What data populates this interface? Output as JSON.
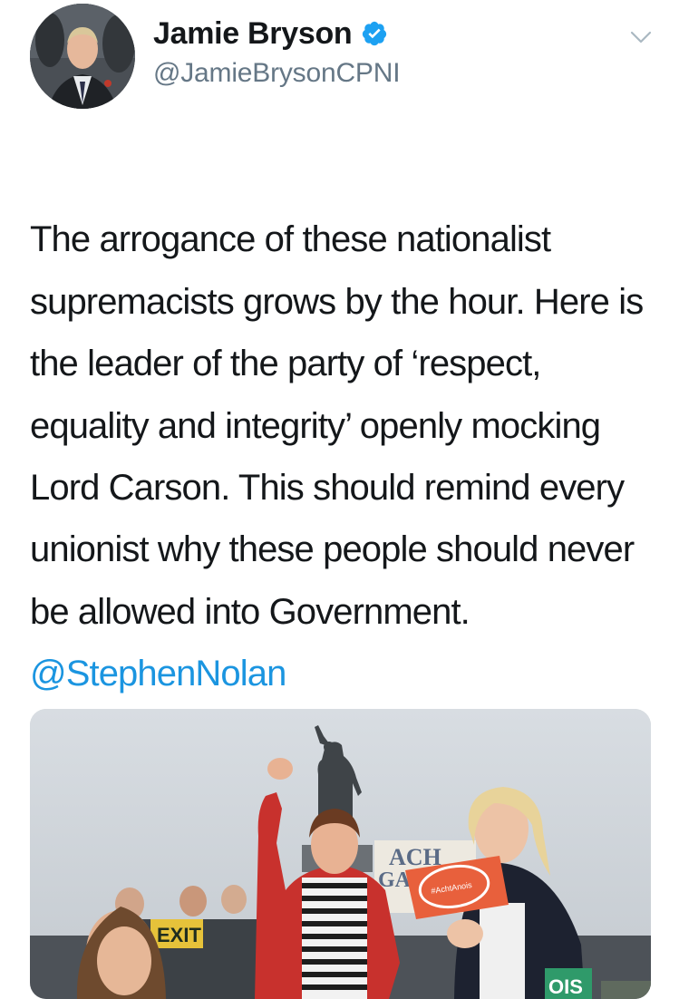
{
  "tweet": {
    "author": {
      "display_name": "Jamie Bryson",
      "handle": "@JamieBrysonCPNI",
      "verified": true
    },
    "body": "The arrogance of these nationalist supremacists grows by the hour. Here is the leader of the party of ‘respect, equality and integrity’ openly mocking Lord Carson. This should remind every unionist why these people should never be allowed into Government.",
    "mention": "@StephenNolan",
    "media": {
      "sign_text_1": "ACH",
      "sign_text_2": "GAE",
      "sign_text_3": "EXIT",
      "sign_text_4": "#AchtAnois",
      "sign_text_5": "OIS"
    }
  },
  "icons": {
    "verified": "verified-badge-icon",
    "more": "chevron-down-icon"
  },
  "colors": {
    "text": "#14171a",
    "secondary": "#657786",
    "link": "#1b95e0",
    "verified": "#1da1f2"
  }
}
